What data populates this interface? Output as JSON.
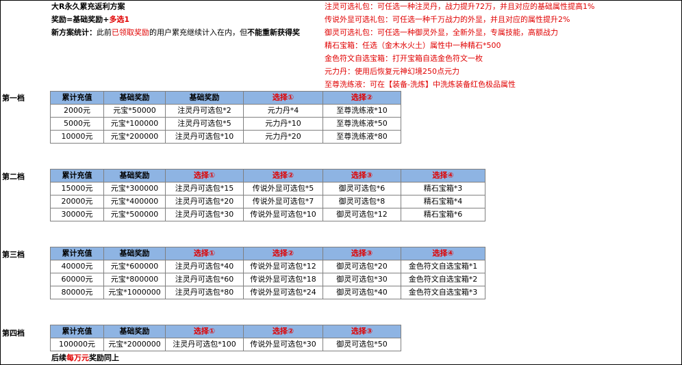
{
  "header": {
    "title": "大R永久累充返利方案",
    "reward_prefix": "奖励=基础奖励+",
    "reward_red": "多选1",
    "stat_label": "新方案统计：",
    "stat_text1": "此前",
    "stat_red": "已领取奖励",
    "stat_text2": "的用户累充继续计入在内，但",
    "stat_bold": "不能重新获得奖"
  },
  "notes": [
    "注灵可选礼包：可任选一种注灵丹，战力提升72万，并且对应的基础属性提高1%",
    "传说外显可选礼包：可任选一种千万战力的外显，并且对应的属性提升2%",
    "御灵可选礼包：可任选一种御灵外显，全新外显，专属技能，高额战力",
    "精石宝箱：任选（金木水火土）属性中一种精石*500",
    "金色符文自选宝箱：打开宝箱自选金色符文一枚",
    "元力丹：使用后恢复元神幻境250点元力",
    "至尊洗练液：可在【装备-洗炼】中洗炼装备红色极品属性"
  ],
  "tiers": [
    {
      "label": "第一档",
      "headers": [
        "累计充值",
        "基础奖励",
        "基础奖励",
        "选择①",
        "选择②"
      ],
      "rows": [
        [
          "2000元",
          "元宝*50000",
          "注灵丹可选包*2",
          "元力丹*4",
          "至尊洗练液*10"
        ],
        [
          "5000元",
          "元宝*100000",
          "注灵丹可选包*5",
          "元力丹*10",
          "至尊洗练液*50"
        ],
        [
          "10000元",
          "元宝*200000",
          "注灵丹可选包*10",
          "元力丹*20",
          "至尊洗练液*80"
        ]
      ]
    },
    {
      "label": "第二档",
      "headers": [
        "累计充值",
        "基础奖励",
        "选择①",
        "选择②",
        "选择③",
        "选择④"
      ],
      "rows": [
        [
          "15000元",
          "元宝*300000",
          "注灵丹可选包*15",
          "传说外显可选包*5",
          "御灵可选包*6",
          "精石宝箱*3"
        ],
        [
          "20000元",
          "元宝*400000",
          "注灵丹可选包*20",
          "传说外显可选包*7",
          "御灵可选包*8",
          "精石宝箱*4"
        ],
        [
          "30000元",
          "元宝*500000",
          "注灵丹可选包*30",
          "传说外显可选包*10",
          "御灵可选包*12",
          "精石宝箱*6"
        ]
      ]
    },
    {
      "label": "第三档",
      "headers": [
        "累计充值",
        "基础奖励",
        "选择①",
        "选择②",
        "选择③",
        "选择④"
      ],
      "rows": [
        [
          "40000元",
          "元宝*600000",
          "注灵丹可选包*40",
          "传说外显可选包*12",
          "御灵可选包*20",
          "金色符文自选宝箱*1"
        ],
        [
          "60000元",
          "元宝*800000",
          "注灵丹可选包*60",
          "传说外显可选包*18",
          "御灵可选包*30",
          "金色符文自选宝箱*2"
        ],
        [
          "80000元",
          "元宝*1000000",
          "注灵丹可选包*80",
          "传说外显可选包*24",
          "御灵可选包*40",
          "金色符文自选宝箱*3"
        ]
      ]
    },
    {
      "label": "第四档",
      "headers": [
        "累计充值",
        "基础奖励",
        "选择①",
        "选择②",
        "选择③"
      ],
      "rows": [
        [
          "100000元",
          "元宝*2000000",
          "注灵丹可选包*100",
          "传说外显可选包*30",
          "御灵可选包*50"
        ]
      ]
    }
  ],
  "footer": {
    "prefix": "后续",
    "red": "每万元",
    "suffix": "奖励同上"
  },
  "colors": {
    "header_bg": "#8eb4e3",
    "accent_red": "#e00000"
  }
}
